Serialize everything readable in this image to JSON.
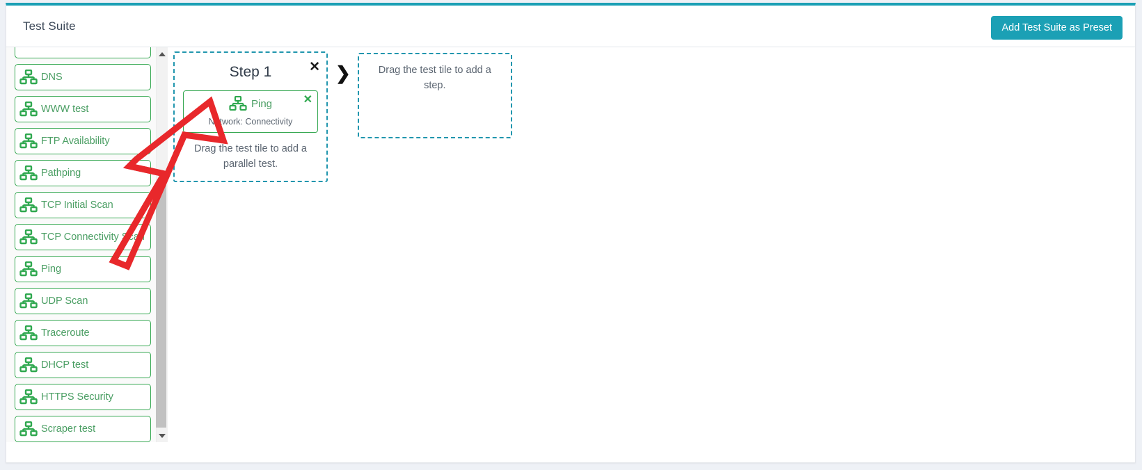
{
  "header": {
    "title": "Test Suite",
    "preset_button_label": "Add Test Suite as Preset"
  },
  "colors": {
    "accent_teal": "#1ba0b5",
    "tile_green": "#36a852",
    "tile_text_green": "#4a9e63",
    "dashed_border": "#2196ae",
    "annotation_red": "#e8282b",
    "text_dark": "#3c4858"
  },
  "sidebar": {
    "scroll_partial_top_item": true,
    "items": [
      {
        "label": "DNS",
        "icon": "network-icon"
      },
      {
        "label": "WWW test",
        "icon": "network-icon"
      },
      {
        "label": "FTP Availability",
        "icon": "network-icon"
      },
      {
        "label": "Pathping",
        "icon": "network-icon"
      },
      {
        "label": "TCP Initial Scan",
        "icon": "network-icon"
      },
      {
        "label": "TCP Connectivity Scan",
        "icon": "network-icon"
      },
      {
        "label": "Ping",
        "icon": "network-icon"
      },
      {
        "label": "UDP Scan",
        "icon": "network-icon"
      },
      {
        "label": "Traceroute",
        "icon": "network-icon"
      },
      {
        "label": "DHCP test",
        "icon": "network-icon"
      },
      {
        "label": "HTTPS Security",
        "icon": "network-icon"
      },
      {
        "label": "Scraper test",
        "icon": "network-icon"
      }
    ],
    "scrollbar": {
      "up_arrow_icon": "caret-up-icon",
      "down_arrow_icon": "caret-down-icon"
    }
  },
  "canvas": {
    "step": {
      "title": "Step 1",
      "close_icon": "close-x-icon",
      "test": {
        "name": "Ping",
        "icon": "network-icon",
        "category": "Network: Connectivity",
        "close_icon": "close-x-icon"
      },
      "parallel_hint": "Drag the test tile to add a parallel test."
    },
    "connector_icon": "chevron-right-icon",
    "drop_zone": {
      "hint": "Drag the test tile to add a step."
    }
  },
  "annotation": {
    "type": "hand-drawn-arrow",
    "color": "#e8282b",
    "points_to": "Ping test tile inside Step 1"
  }
}
